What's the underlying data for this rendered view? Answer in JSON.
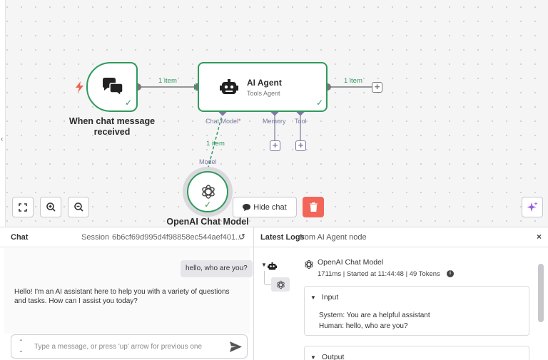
{
  "canvas": {
    "trigger_node": {
      "title": "When chat message received",
      "icon": "chat-bubbles-icon",
      "trigger_icon": "lightning-icon"
    },
    "agent_node": {
      "title": "AI Agent",
      "subtitle": "Tools Agent",
      "icon": "robot-icon"
    },
    "model_node": {
      "title": "OpenAI Chat Model",
      "icon": "openai-icon"
    },
    "wire_labels": {
      "trigger_to_agent": "1 item",
      "agent_output": "1 item",
      "model_to_agent": "1 item"
    },
    "ports": {
      "chat_model": "Chat Model",
      "required_marker": "*",
      "memory": "Memory",
      "tool": "Tool",
      "model": "Model"
    },
    "toolbar": {
      "hide_chat": "Hide chat"
    },
    "colors": {
      "success": "#2f9a5c",
      "delete": "#f2665a",
      "port": "#7a7aa0",
      "assist": "#9b5de5"
    }
  },
  "chat": {
    "title": "Chat",
    "session_label": "Session",
    "session_id": "6b6cf69d995d4f98858ec544aef401...",
    "messages": [
      {
        "role": "user",
        "text": "hello, who are you?"
      },
      {
        "role": "bot",
        "text": "Hello! I'm an AI assistant here to help you with a variety of questions and tasks. How can I assist you today?"
      }
    ],
    "input_placeholder": "Type a message, or press 'up' arrow for previous one",
    "history_up": "⌃",
    "history_down": "⌄"
  },
  "logs": {
    "title": "Latest Logs",
    "source": "from AI Agent node",
    "entry": {
      "model_name": "OpenAI Chat Model",
      "meta": "1711ms | Started at 11:44:48 | 49 Tokens",
      "input_title": "Input",
      "input_lines": [
        "System: You are a helpful assistant",
        "Human: hello, who are you?"
      ],
      "output_title": "Output"
    },
    "close": "×",
    "info": "i"
  }
}
